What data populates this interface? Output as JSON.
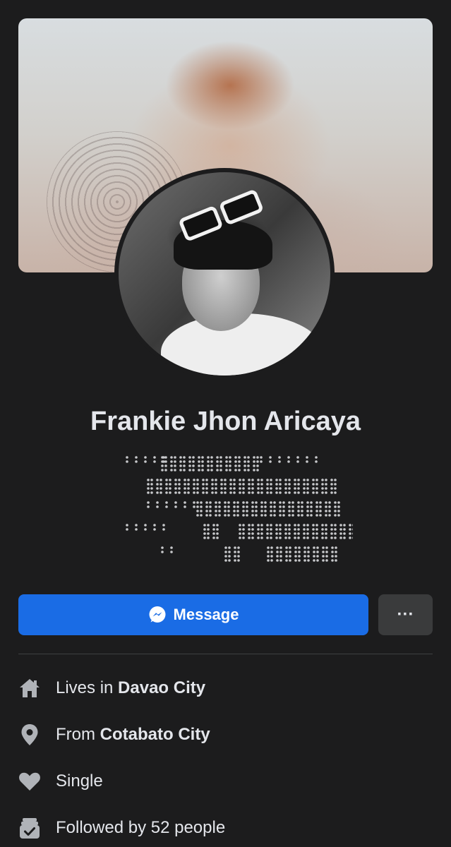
{
  "profile": {
    "name": "Frankie Jhon Aricaya"
  },
  "actions": {
    "message_label": "Message",
    "more_label": "···"
  },
  "details": {
    "lives_prefix": "Lives in ",
    "lives_value": "Davao City",
    "from_prefix": "From ",
    "from_value": "Cotabato City",
    "relationship": "Single",
    "followers": "Followed by 52 people"
  },
  "icons": {
    "home": "home-icon",
    "location": "location-pin-icon",
    "relationship": "heart-icon",
    "followers": "followers-icon",
    "message": "messenger-icon",
    "more": "more-options-icon"
  },
  "colors": {
    "background": "#1c1c1d",
    "primary_button": "#1a6ce5",
    "secondary_button": "#3a3b3c",
    "text": "#e4e6eb",
    "icon": "#b0b3b8"
  }
}
